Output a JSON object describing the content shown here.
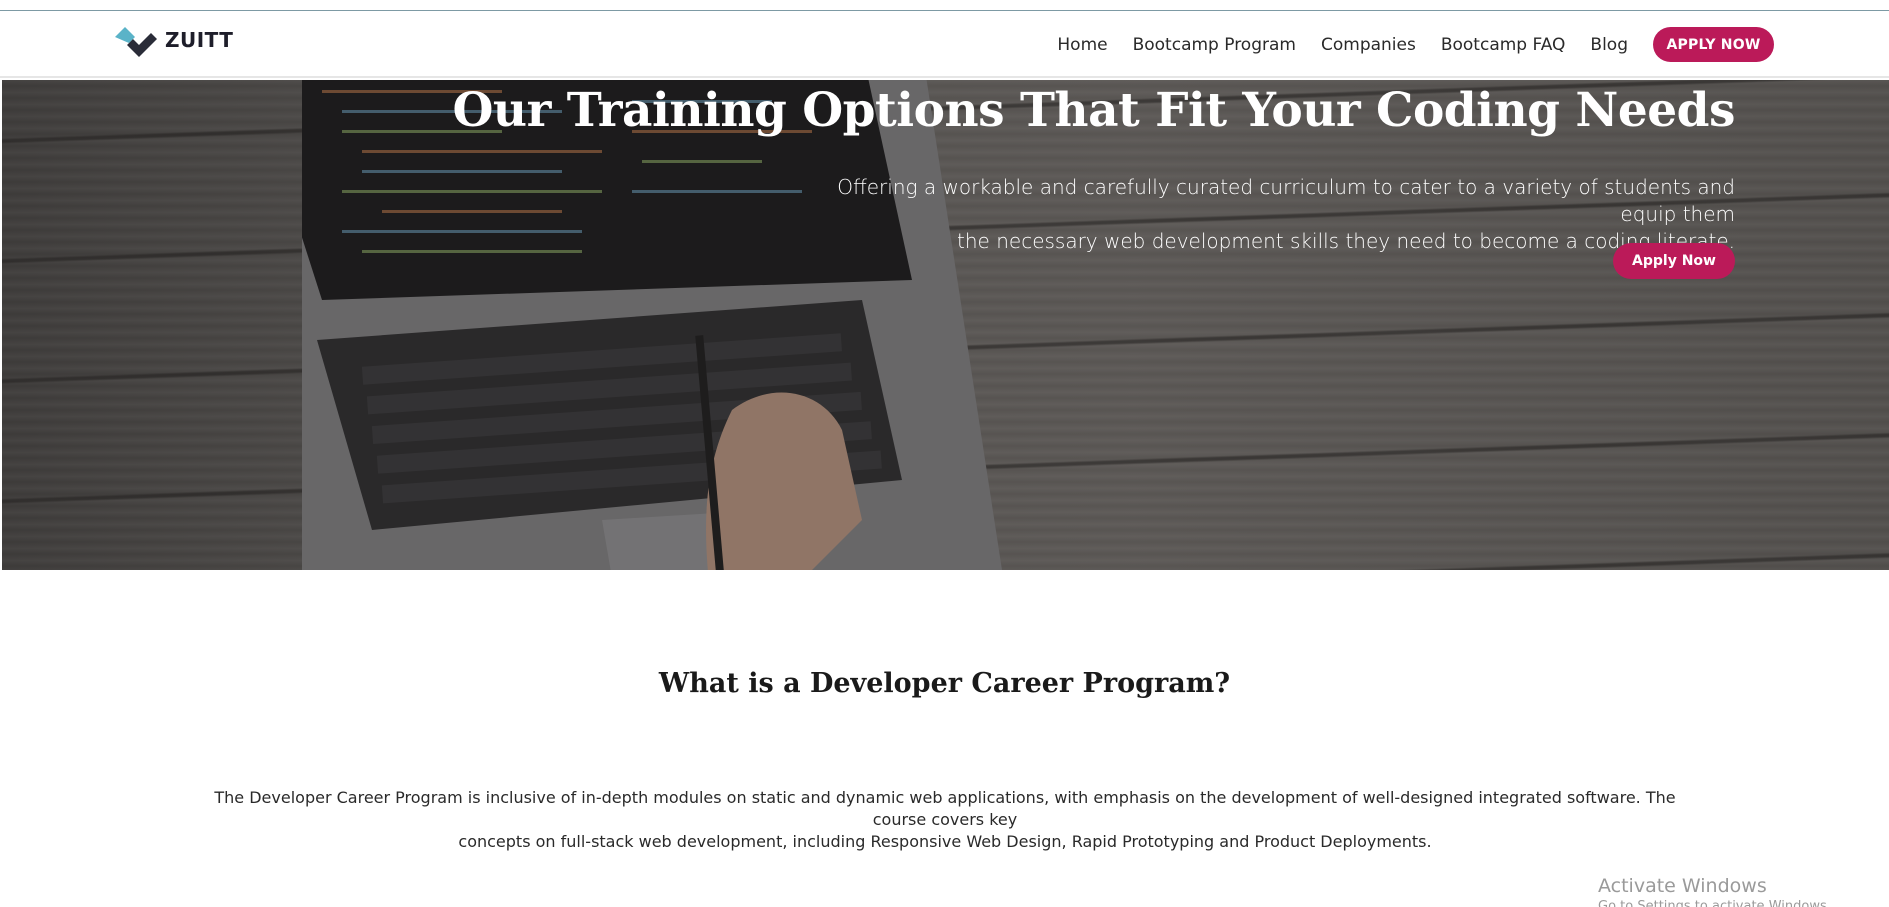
{
  "brand": {
    "name": "ZUITT"
  },
  "nav": {
    "links": [
      "Home",
      "Bootcamp Program",
      "Companies",
      "Bootcamp FAQ",
      "Blog"
    ],
    "apply_label": "APPLY NOW"
  },
  "hero": {
    "title": "Our Training Options That Fit Your Coding Needs",
    "subtitle_line1": "Offering a workable and carefully curated curriculum to cater to a variety of students and equip them",
    "subtitle_line2": "the necessary web development skills they need to become a coding literate.",
    "button_label": "Apply Now"
  },
  "section": {
    "title": "What is a Developer Career Program?",
    "body_line1": "The Developer Career Program is inclusive of in-depth modules on static and dynamic web applications, with emphasis on the development of well-designed integrated software. The course covers key",
    "body_line2": "concepts on full-stack web development, including Responsive Web Design, Rapid Prototyping and Product Deployments."
  },
  "watermark": {
    "line1": "Activate Windows",
    "line2": "Go to Settings to activate Windows."
  },
  "colors": {
    "accent": "#bb1a59",
    "logo_teal": "#5ab3c8",
    "logo_dark": "#1e1e2a"
  }
}
